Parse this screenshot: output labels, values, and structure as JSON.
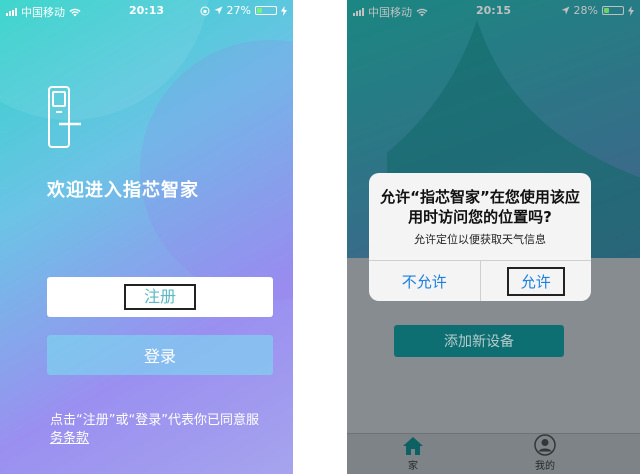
{
  "left_phone": {
    "status": {
      "carrier": "中国移动",
      "time": "20:13",
      "battery": "27%",
      "battery_level": 0.27
    },
    "welcome": "欢迎进入指芯智家",
    "register_label": "注册",
    "login_label": "登录",
    "terms_text": "点击“注册”或“登录”代表你已同意服",
    "terms_link": "务条款",
    "colors": {
      "accent": "#5bb8c4"
    }
  },
  "right_phone": {
    "status": {
      "carrier": "中国移动",
      "time": "20:15",
      "battery": "28%",
      "battery_level": 0.28
    },
    "dialog": {
      "title": "允许“指芯智家”在您使用该应用时访问您的位置吗?",
      "message": "允许定位以便获取天气信息",
      "deny_label": "不允许",
      "allow_label": "允许"
    },
    "add_device_label": "添加新设备",
    "tabs": [
      {
        "label": "家",
        "icon": "home-icon"
      },
      {
        "label": "我的",
        "icon": "user-icon"
      }
    ],
    "colors": {
      "primary": "#0f7f82",
      "ios_blue": "#1a7fe0"
    }
  }
}
